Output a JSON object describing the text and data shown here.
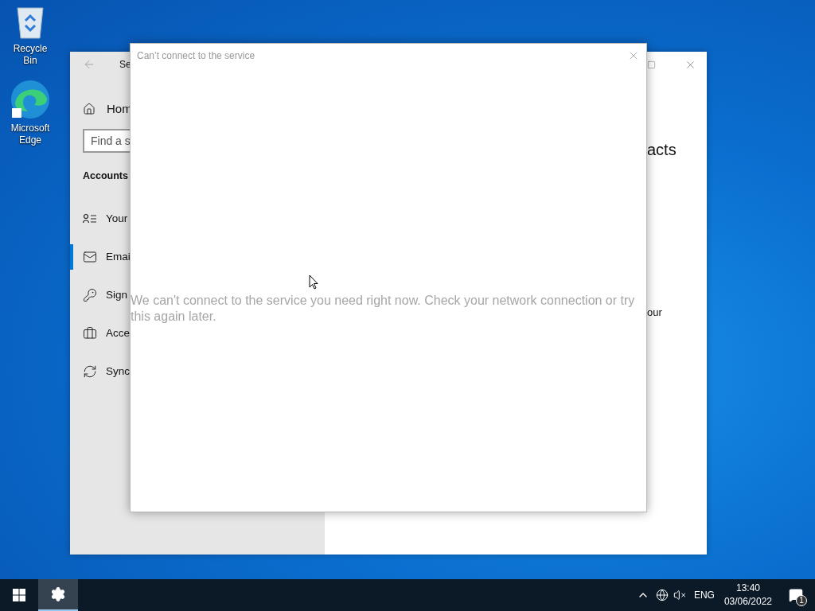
{
  "desktop_icons": [
    {
      "kind": "recycle",
      "label": "Recycle Bin"
    },
    {
      "kind": "edge",
      "label": "Microsoft Edge"
    }
  ],
  "settings_window": {
    "title": "Se",
    "home": "Hom",
    "search": {
      "placeholder": "Find a s"
    },
    "section": "Accounts",
    "items": [
      {
        "kind": "person",
        "label": "Your",
        "selected": false
      },
      {
        "kind": "mail",
        "label": "Emai",
        "selected": true
      },
      {
        "kind": "key",
        "label": "Sign",
        "selected": false
      },
      {
        "kind": "briefcase",
        "label": "Acce",
        "selected": false
      },
      {
        "kind": "sync",
        "label": "Sync",
        "selected": false
      }
    ],
    "heading": "acts",
    "body": "our"
  },
  "dialog": {
    "title": "Can’t connect to the service",
    "message": "We can't connect to the service you need right now. Check your network connection or try this again later."
  },
  "taskbar": {
    "apps": [
      {
        "kind": "settings",
        "selected": true
      }
    ],
    "language": "ENG",
    "time": "13:40",
    "date": "03/06/2022",
    "notifications": "1"
  }
}
